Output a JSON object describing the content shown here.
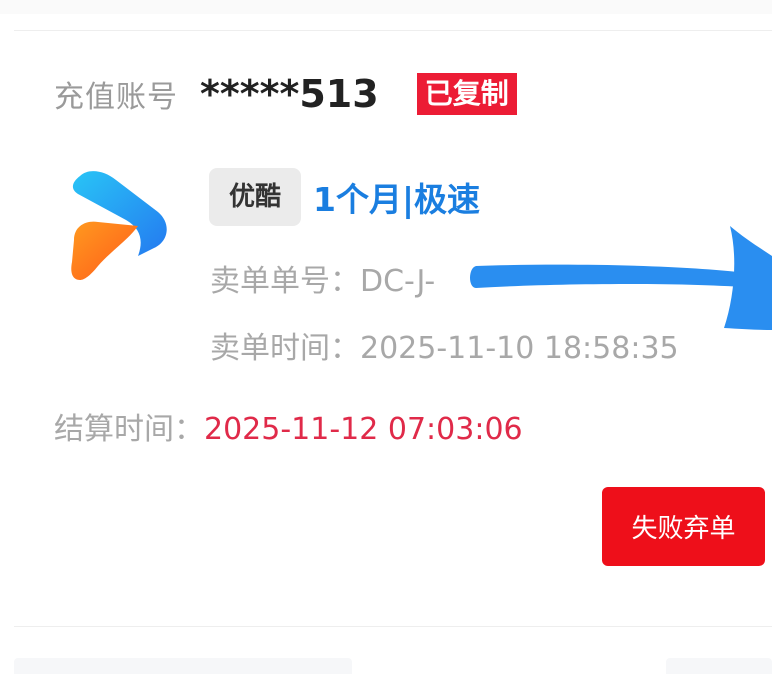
{
  "order_card": {
    "account_label": "充值账号",
    "account_value": "*****513",
    "copied_badge": "已复制",
    "logo_icon": "youku-play-logo-icon",
    "platform_tag": "优酷",
    "product_name": "1个月|极速",
    "order_number_label": "卖单单号：",
    "order_number_value": "DC-J-",
    "order_time_label": "卖单时间：",
    "order_time_value": "2025-11-10 18:58:35",
    "settle_time_label": "结算时间：",
    "settle_time_value": "2025-11-12 07:03:06",
    "abandon_button": "失败弃单"
  },
  "annotation": {
    "icon": "arrow-right-icon",
    "color": "#2a8ef0"
  },
  "colors": {
    "badge": "#ec1c35",
    "product_name": "#1a7ee0",
    "settle_time": "#e02a49",
    "abandon_button": "#ee0f1a",
    "platform_tag_bg": "#ebebeb"
  }
}
